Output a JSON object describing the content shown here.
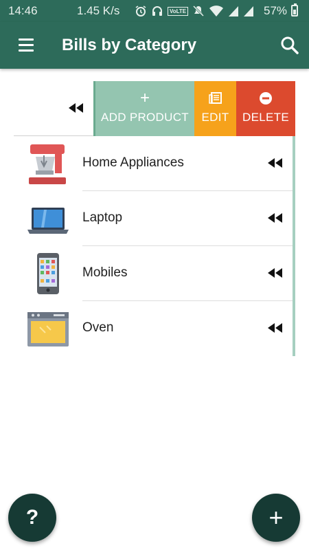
{
  "status_bar": {
    "time": "14:46",
    "net_speed": "1.45 K/s",
    "volte_label": "VoLTE",
    "battery": "57%",
    "icons": [
      "alarm-icon",
      "headset-icon",
      "volte-icon",
      "mute-icon",
      "wifi-icon",
      "signal-icon",
      "signal-icon",
      "battery-icon"
    ]
  },
  "app_bar": {
    "title": "Bills by Category",
    "menu_icon": "hamburger-menu-icon",
    "search_icon": "search-icon"
  },
  "swipe_actions": {
    "add": {
      "label": "ADD PRODUCT",
      "icon": "plus-icon",
      "color": "#94c5b0"
    },
    "edit": {
      "label": "EDIT",
      "icon": "edit-icon",
      "color": "#f6a21b"
    },
    "delete": {
      "label": "DELETE",
      "icon": "minus-circle-icon",
      "color": "#dc4a2e"
    }
  },
  "categories": [
    {
      "name": "Home Appliances",
      "icon": "stand-mixer-icon"
    },
    {
      "name": "Laptop",
      "icon": "laptop-icon"
    },
    {
      "name": "Mobiles",
      "icon": "mobile-phone-icon"
    },
    {
      "name": "Oven",
      "icon": "oven-icon"
    }
  ],
  "fab": {
    "help_label": "?",
    "add_label": "+"
  },
  "colors": {
    "primary": "#2d6b5a",
    "fab": "#163a34"
  }
}
